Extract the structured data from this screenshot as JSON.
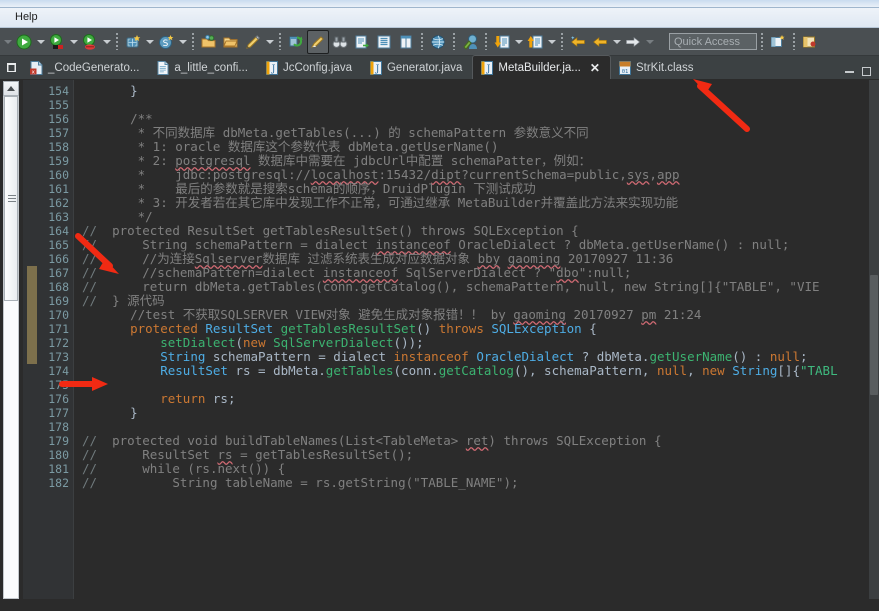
{
  "window": {
    "menu": [
      "Help"
    ],
    "quick_access_placeholder": "Quick Access"
  },
  "toolbar": {
    "buttons": [
      {
        "name": "run-button",
        "label": "Run"
      },
      {
        "name": "run-dropdown",
        "label": "Run History"
      },
      {
        "name": "debug-button",
        "label": "Debug"
      },
      {
        "name": "debug-dropdown",
        "label": "Debug History"
      },
      {
        "name": "run-last-tool-button",
        "label": "Run Last Tool"
      },
      {
        "name": "run-last-tool-dropdown",
        "label": "Run Last Tool History"
      },
      {
        "name": "new-server-button",
        "label": "New Server"
      },
      {
        "name": "new-server-dropdown",
        "label": "New Server Options"
      },
      {
        "name": "new-sql-button",
        "label": "New SQL"
      },
      {
        "name": "new-sql-dropdown",
        "label": "New SQL Options"
      },
      {
        "name": "open-project-button",
        "label": "Open Project"
      },
      {
        "name": "open-folder-button",
        "label": "Open Folder"
      },
      {
        "name": "edit-pen-button",
        "label": "Edit"
      },
      {
        "name": "edit-pen-dropdown",
        "label": "Edit Options"
      },
      {
        "name": "refresh-workspace-button",
        "label": "Refresh"
      },
      {
        "name": "toggle-highlight-button",
        "label": "Toggle Mark Occurrences"
      },
      {
        "name": "search-button",
        "label": "Search"
      },
      {
        "name": "open-task-button",
        "label": "Open Task"
      },
      {
        "name": "show-view-button",
        "label": "Show View"
      },
      {
        "name": "column-view-button",
        "label": "Column View"
      },
      {
        "name": "web-browser-button",
        "label": "Open Web Browser"
      },
      {
        "name": "user-profile-button",
        "label": "User"
      },
      {
        "name": "import-button",
        "label": "Import"
      },
      {
        "name": "import-dropdown",
        "label": "Import Options"
      },
      {
        "name": "export-button",
        "label": "Export"
      },
      {
        "name": "export-dropdown",
        "label": "Export Options"
      },
      {
        "name": "back-history-button",
        "label": "Back"
      },
      {
        "name": "previous-edit-button",
        "label": "Previous Edit Location"
      },
      {
        "name": "previous-edit-dropdown",
        "label": "Previous Edit History"
      },
      {
        "name": "forward-button",
        "label": "Forward"
      },
      {
        "name": "forward-dropdown",
        "label": "Forward History"
      },
      {
        "name": "new-perspective-button",
        "label": "Open Perspective"
      },
      {
        "name": "java-perspective-button",
        "label": "Java Perspective"
      }
    ]
  },
  "tabs": [
    {
      "label": "_CodeGenerato...",
      "icon": "xml-file-icon",
      "active": false
    },
    {
      "label": "a_little_confi...",
      "icon": "text-file-icon",
      "active": false
    },
    {
      "label": "JcConfig.java",
      "icon": "java-file-icon",
      "active": false
    },
    {
      "label": "Generator.java",
      "icon": "java-file-icon",
      "active": false
    },
    {
      "label": "MetaBuilder.ja...",
      "icon": "java-file-icon",
      "active": true
    },
    {
      "label": "StrKit.class",
      "icon": "class-file-icon",
      "active": false
    }
  ],
  "editor": {
    "first_line": 154,
    "colors": {
      "background": "#2b2b2b",
      "gutter": "#313335",
      "line_number": "#7b9aa3",
      "comment": "#808080",
      "keyword": "#cc7832",
      "type": "#4eade5",
      "method": "#2aa198",
      "string": "#3fba7f",
      "plain": "#a9b7c6"
    },
    "lines": [
      {
        "n": 154,
        "commented": false,
        "fold": false,
        "tokens": [
          {
            "t": "    ",
            "c": "pln"
          },
          {
            "t": "}",
            "c": "pln"
          }
        ]
      },
      {
        "n": 155,
        "commented": false,
        "fold": false,
        "tokens": []
      },
      {
        "n": 156,
        "commented": false,
        "fold": true,
        "tokens": [
          {
            "t": "    ",
            "c": "pln"
          },
          {
            "t": "/**",
            "c": "cmt"
          }
        ]
      },
      {
        "n": 157,
        "commented": false,
        "fold": false,
        "tokens": [
          {
            "t": "     * 不同数据库 dbMeta.getTables(...) 的 schemaPattern 参数意义不同",
            "c": "cmt"
          }
        ]
      },
      {
        "n": 158,
        "commented": false,
        "fold": false,
        "tokens": [
          {
            "t": "     * 1: oracle 数据库这个参数代表 dbMeta.getUserName()",
            "c": "cmt"
          }
        ]
      },
      {
        "n": 159,
        "commented": false,
        "fold": false,
        "tokens": [
          {
            "t": "     * 2: ",
            "c": "cmt"
          },
          {
            "t": "postgresql",
            "c": "cmt sq"
          },
          {
            "t": " 数据库中需要在 jdbcUrl中配置 schemaPatter，例如：",
            "c": "cmt"
          }
        ]
      },
      {
        "n": 160,
        "commented": false,
        "fold": false,
        "tokens": [
          {
            "t": "     *    jdbc:postgresql://",
            "c": "cmt"
          },
          {
            "t": "localhost",
            "c": "cmt sq"
          },
          {
            "t": ":15432/",
            "c": "cmt"
          },
          {
            "t": "dipt",
            "c": "cmt sq"
          },
          {
            "t": "?currentSchema=public,",
            "c": "cmt"
          },
          {
            "t": "sys",
            "c": "cmt sq"
          },
          {
            "t": ",",
            "c": "cmt"
          },
          {
            "t": "app",
            "c": "cmt sq"
          }
        ]
      },
      {
        "n": 161,
        "commented": false,
        "fold": false,
        "tokens": [
          {
            "t": "     *    最后的参数就是搜索schema的顺序，DruidPlugin 下测试成功",
            "c": "cmt"
          }
        ]
      },
      {
        "n": 162,
        "commented": false,
        "fold": false,
        "tokens": [
          {
            "t": "     * 3: 开发者若在其它库中发现工作不正常，可通过继承 MetaBuilder并覆盖此方法来实现功能",
            "c": "cmt"
          }
        ]
      },
      {
        "n": 163,
        "commented": false,
        "fold": false,
        "tokens": [
          {
            "t": "     */",
            "c": "cmt"
          }
        ]
      },
      {
        "n": 164,
        "commented": true,
        "fold": false,
        "tokens": [
          {
            "t": "  protected ResultSet getTablesResultSet() throws SQLException {",
            "c": "cmt"
          }
        ]
      },
      {
        "n": 165,
        "commented": true,
        "fold": false,
        "tokens": [
          {
            "t": "      String schemaPattern = dialect ",
            "c": "cmt"
          },
          {
            "t": "instanceof",
            "c": "cmt sq"
          },
          {
            "t": " OracleDialect ? dbMeta.getUserName() : null;",
            "c": "cmt"
          }
        ]
      },
      {
        "n": 166,
        "commented": true,
        "fold": false,
        "tokens": [
          {
            "t": "      //为连接",
            "c": "cmt"
          },
          {
            "t": "Sqlserver",
            "c": "cmt sq"
          },
          {
            "t": "数据库 过滤系统表生成对应数据对象 ",
            "c": "cmt"
          },
          {
            "t": "bby",
            "c": "cmt sq"
          },
          {
            "t": " ",
            "c": "cmt"
          },
          {
            "t": "gaoming",
            "c": "cmt sq"
          },
          {
            "t": " 20170927 11:36",
            "c": "cmt"
          }
        ]
      },
      {
        "n": 167,
        "commented": true,
        "fold": false,
        "tokens": [
          {
            "t": "      //schemaPattern=dialect ",
            "c": "cmt"
          },
          {
            "t": "instanceof",
            "c": "cmt sq"
          },
          {
            "t": " SqlServerDialect ? \"",
            "c": "cmt"
          },
          {
            "t": "dbo",
            "c": "cmt sq"
          },
          {
            "t": "\":null;",
            "c": "cmt"
          }
        ]
      },
      {
        "n": 168,
        "commented": true,
        "fold": false,
        "tokens": [
          {
            "t": "      return dbMeta.getTables(conn.getCatalog(), schemaPattern, null, new String[]{\"TABLE\", \"VIE",
            "c": "cmt"
          }
        ]
      },
      {
        "n": 169,
        "commented": true,
        "fold": false,
        "tokens": [
          {
            "t": "  } 源代码",
            "c": "cmt"
          }
        ]
      },
      {
        "n": 170,
        "commented": false,
        "fold": false,
        "tokens": [
          {
            "t": "    //test 不获取SQLSERVER VIEW对象 避免生成对象报错！！ by ",
            "c": "cmt"
          },
          {
            "t": "gaoming",
            "c": "cmt sq"
          },
          {
            "t": " 20170927 ",
            "c": "cmt"
          },
          {
            "t": "pm",
            "c": "cmt sq"
          },
          {
            "t": " 21:24",
            "c": "cmt"
          }
        ]
      },
      {
        "n": 171,
        "commented": false,
        "fold": true,
        "tokens": [
          {
            "t": "    ",
            "c": "pln"
          },
          {
            "t": "protected",
            "c": "kw"
          },
          {
            "t": " ",
            "c": "pln"
          },
          {
            "t": "ResultSet",
            "c": "typ"
          },
          {
            "t": " ",
            "c": "pln"
          },
          {
            "t": "getTablesResultSet",
            "c": "mth2"
          },
          {
            "t": "() ",
            "c": "pln"
          },
          {
            "t": "throws",
            "c": "kw"
          },
          {
            "t": " ",
            "c": "pln"
          },
          {
            "t": "SQLException",
            "c": "typ"
          },
          {
            "t": " {",
            "c": "pln"
          }
        ]
      },
      {
        "n": 172,
        "commented": false,
        "fold": false,
        "tokens": [
          {
            "t": "        ",
            "c": "pln"
          },
          {
            "t": "setDialect",
            "c": "mth2"
          },
          {
            "t": "(",
            "c": "pln"
          },
          {
            "t": "new",
            "c": "kw"
          },
          {
            "t": " ",
            "c": "pln"
          },
          {
            "t": "SqlServerDialect",
            "c": "mth2"
          },
          {
            "t": "());",
            "c": "pln"
          }
        ]
      },
      {
        "n": 173,
        "commented": false,
        "fold": false,
        "tokens": [
          {
            "t": "        ",
            "c": "pln"
          },
          {
            "t": "String",
            "c": "typ"
          },
          {
            "t": " schemaPattern = dialect ",
            "c": "pln"
          },
          {
            "t": "instanceof",
            "c": "kw"
          },
          {
            "t": " ",
            "c": "pln"
          },
          {
            "t": "OracleDialect",
            "c": "typ"
          },
          {
            "t": " ? dbMeta.",
            "c": "pln"
          },
          {
            "t": "getUserName",
            "c": "mth2"
          },
          {
            "t": "() : ",
            "c": "pln"
          },
          {
            "t": "null",
            "c": "kw"
          },
          {
            "t": ";",
            "c": "pln"
          }
        ]
      },
      {
        "n": 174,
        "commented": false,
        "fold": false,
        "tokens": [
          {
            "t": "        ",
            "c": "pln"
          },
          {
            "t": "ResultSet",
            "c": "typ"
          },
          {
            "t": " rs = dbMeta.",
            "c": "pln"
          },
          {
            "t": "getTables",
            "c": "mth2"
          },
          {
            "t": "(conn.",
            "c": "pln"
          },
          {
            "t": "getCatalog",
            "c": "mth2"
          },
          {
            "t": "(), schemaPattern, ",
            "c": "pln"
          },
          {
            "t": "null",
            "c": "kw"
          },
          {
            "t": ", ",
            "c": "pln"
          },
          {
            "t": "new",
            "c": "kw"
          },
          {
            "t": " ",
            "c": "pln"
          },
          {
            "t": "String",
            "c": "typ"
          },
          {
            "t": "[]{",
            "c": "pln"
          },
          {
            "t": "\"TABL",
            "c": "str"
          }
        ]
      },
      {
        "n": 175,
        "commented": false,
        "fold": false,
        "tokens": []
      },
      {
        "n": 176,
        "commented": false,
        "fold": false,
        "tokens": [
          {
            "t": "        ",
            "c": "pln"
          },
          {
            "t": "return",
            "c": "kw"
          },
          {
            "t": " rs;",
            "c": "pln"
          }
        ]
      },
      {
        "n": 177,
        "commented": false,
        "fold": false,
        "tokens": [
          {
            "t": "    }",
            "c": "pln"
          }
        ]
      },
      {
        "n": 178,
        "commented": false,
        "fold": false,
        "tokens": []
      },
      {
        "n": 179,
        "commented": true,
        "fold": false,
        "tokens": [
          {
            "t": "  protected void buildTableNames(List<TableMeta> ",
            "c": "cmt"
          },
          {
            "t": "ret",
            "c": "cmt sq"
          },
          {
            "t": ") throws SQLException {",
            "c": "cmt"
          }
        ]
      },
      {
        "n": 180,
        "commented": true,
        "fold": false,
        "tokens": [
          {
            "t": "      ResultSet ",
            "c": "cmt"
          },
          {
            "t": "rs",
            "c": "cmt sq"
          },
          {
            "t": " = getTablesResultSet();",
            "c": "cmt"
          }
        ]
      },
      {
        "n": 181,
        "commented": true,
        "fold": false,
        "tokens": [
          {
            "t": "      while (rs.next()) {",
            "c": "cmt"
          }
        ]
      },
      {
        "n": 182,
        "commented": true,
        "fold": false,
        "tokens": [
          {
            "t": "          String tableName = rs.getString(\"TABLE_NAME\");",
            "c": "cmt"
          }
        ]
      }
    ]
  },
  "annotations": {
    "arrow_color": "#f12a13",
    "arrows": [
      {
        "name": "arrow-pointing-at-active-tab"
      },
      {
        "name": "arrow-pointing-at-line-164"
      },
      {
        "name": "arrow-pointing-at-line-170"
      }
    ]
  }
}
